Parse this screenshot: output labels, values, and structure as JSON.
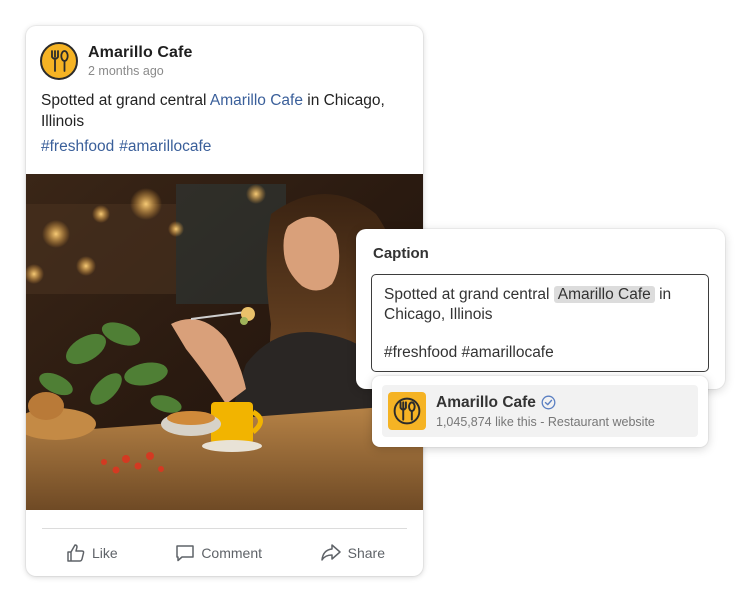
{
  "post": {
    "author": "Amarillo Cafe",
    "time": "2 months ago",
    "text_before": "Spotted at grand central ",
    "text_link": "Amarillo Cafe",
    "text_after": " in Chicago, Illinois",
    "hashtags": [
      "#freshfood",
      "#amarillocafe"
    ],
    "photo_icon": "woman-eating-cafe-photo",
    "actions": {
      "like": "Like",
      "comment": "Comment",
      "share": "Share"
    }
  },
  "caption": {
    "title": "Caption",
    "text_before": "Spotted at grand central",
    "mention": "Amarillo Cafe",
    "text_after": "in Chicago, Illinois",
    "hashtags": "#freshfood #amarillocafe"
  },
  "suggestion": {
    "name": "Amarillo Cafe",
    "meta": "1,045,874 like this - Restaurant website",
    "verified_icon": "verified-check-icon"
  },
  "colors": {
    "brand_yellow": "#f5b324",
    "link_blue": "#3a5f9a",
    "action_gray": "#5f6368"
  }
}
